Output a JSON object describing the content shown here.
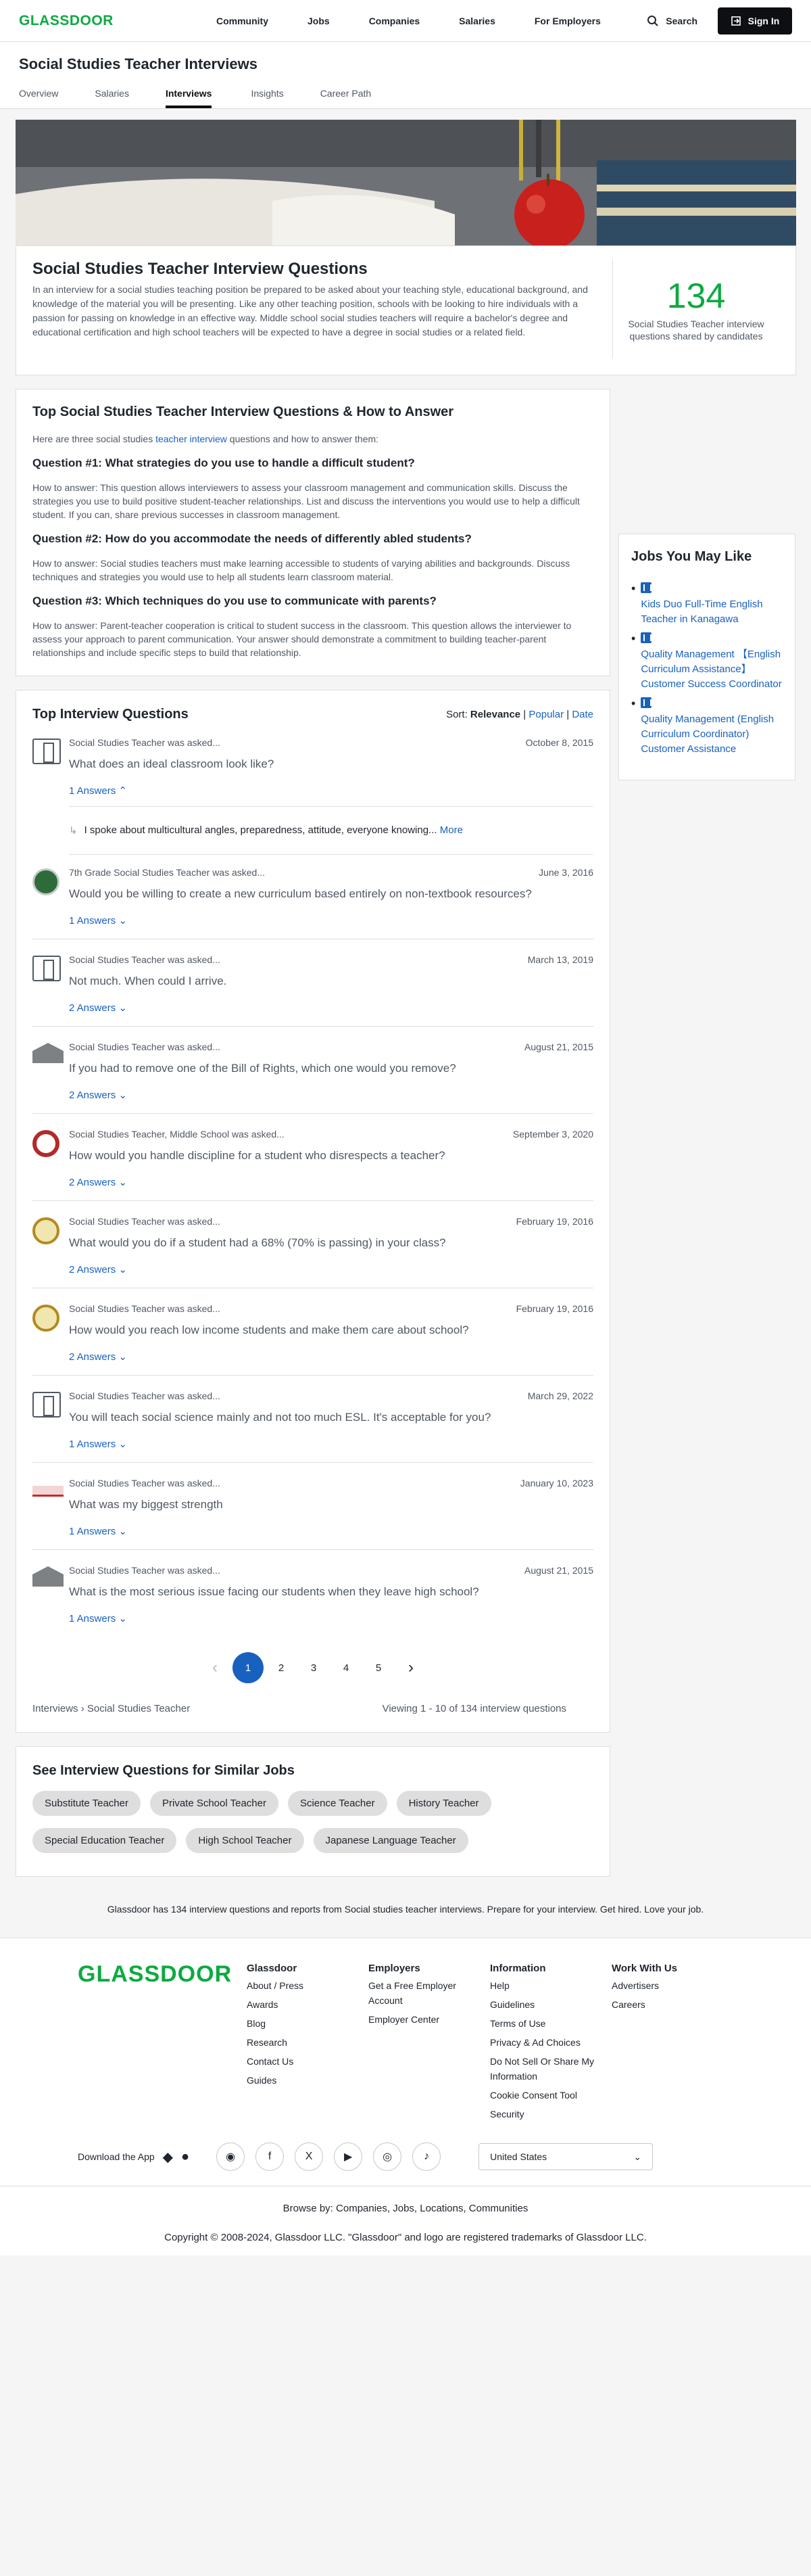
{
  "nav": {
    "logo": "GLASSDOOR",
    "links": [
      "Community",
      "Jobs",
      "Companies",
      "Salaries",
      "For Employers"
    ],
    "search": "Search",
    "signin": "Sign In"
  },
  "page": {
    "title": "Social Studies Teacher Interviews",
    "tabs": [
      "Overview",
      "Salaries",
      "Interviews",
      "Insights",
      "Career Path"
    ],
    "active_tab": "Interviews"
  },
  "intro": {
    "title": "Social Studies Teacher Interview Questions",
    "body": "In an interview for a social studies teaching position be prepared to be asked about your teaching style, educational background, and knowledge of the material you will be presenting. Like any other teaching position, schools with be looking to hire individuals with a passion for passing on knowledge in an effective way. Middle school social studies teachers will require a bachelor's degree and educational certification and high school teachers will be expected to have a degree in social studies or a related field.",
    "count": "134",
    "count_caption": "Social Studies Teacher interview questions shared by candidates"
  },
  "howto": {
    "title": "Top Social Studies Teacher Interview Questions & How to Answer",
    "lead_pre": "Here are three social studies ",
    "lead_link": "teacher interview",
    "lead_post": " questions and how to answer them:",
    "q1": "Question #1: What strategies do you use to handle a difficult student?",
    "a1": "How to answer: This question allows interviewers to assess your classroom management and communication skills. Discuss the strategies you use to build positive student-teacher relationships. List and discuss the interventions you would use to help a difficult student. If you can, share previous successes in classroom management.",
    "q2": "Question #2: How do you accommodate the needs of differently abled students?",
    "a2": "How to answer: Social studies teachers must make learning accessible to students of varying abilities and backgrounds. Discuss techniques and strategies you would use to help all students learn classroom material.",
    "q3": "Question #3: Which techniques do you use to communicate with parents?",
    "a3": "How to answer: Parent-teacher cooperation is critical to student success in the classroom. This question allows the interviewer to assess your approach to parent communication. Your answer should demonstrate a commitment to building teacher-parent relationships and include specific steps to build that relationship."
  },
  "jobs": {
    "title": "Jobs You May Like",
    "items": [
      "Kids Duo Full-Time English Teacher in Kanagawa",
      "Quality Management 【English Curriculum Assistance】 Customer Success Coordinator",
      "Quality Management (English Curriculum Coordinator) Customer Assistance"
    ]
  },
  "questions": {
    "title": "Top Interview Questions",
    "sort_label": "Sort:",
    "sort_options": [
      "Relevance",
      "Popular",
      "Date"
    ],
    "items": [
      {
        "role": "Social Studies Teacher was asked...",
        "date": "October 8, 2015",
        "q": "What does an ideal classroom look like?",
        "answers": "1 Answers"
      },
      {
        "role": "7th Grade Social Studies Teacher was asked...",
        "date": "June 3, 2016",
        "q": "Would you be willing to create a new curriculum based entirely on non-textbook resources?",
        "answers": "1 Answers"
      },
      {
        "role": "Social Studies Teacher was asked...",
        "date": "March 13, 2019",
        "q": "Not much. When could I arrive.",
        "answers": "2 Answers"
      },
      {
        "role": "Social Studies Teacher was asked...",
        "date": "August 21, 2015",
        "q": "If you had to remove one of the Bill of Rights, which one would you remove?",
        "answers": "2 Answers"
      },
      {
        "role": "Social Studies Teacher, Middle School was asked...",
        "date": "September 3, 2020",
        "q": "How would you handle discipline for a student who disrespects a teacher?",
        "answers": "2 Answers"
      },
      {
        "role": "Social Studies Teacher was asked...",
        "date": "February 19, 2016",
        "q": "What would you do if a student had a 68% (70% is passing) in your class?",
        "answers": "2 Answers"
      },
      {
        "role": "Social Studies Teacher was asked...",
        "date": "February 19, 2016",
        "q": "How would you reach low income students and make them care about school?",
        "answers": "2 Answers"
      },
      {
        "role": "Social Studies Teacher was asked...",
        "date": "March 29, 2022",
        "q": "You will teach social science mainly and not too much ESL. It's acceptable for you?",
        "answers": "1 Answers"
      },
      {
        "role": "Social Studies Teacher was asked...",
        "date": "January 10, 2023",
        "q": "What was my biggest strength",
        "answers": "1 Answers"
      },
      {
        "role": "Social Studies Teacher was asked...",
        "date": "August 21, 2015",
        "q": "What is the most serious issue facing our students when they leave high school?",
        "answers": "1 Answers"
      }
    ],
    "expanded_answer": "I spoke about multicultural angles, preparedness, attitude, everyone knowing...",
    "more": "More",
    "pages": [
      "1",
      "2",
      "3",
      "4",
      "5"
    ],
    "breadcrumb_1": "Interviews",
    "breadcrumb_2": "Social Studies Teacher",
    "viewing": "Viewing 1 - 10 of 134 interview questions"
  },
  "similar": {
    "title": "See Interview Questions for Similar Jobs",
    "chips": [
      "Substitute Teacher",
      "Private School Teacher",
      "Science Teacher",
      "History Teacher",
      "Special Education Teacher",
      "High School Teacher",
      "Japanese Language Teacher"
    ]
  },
  "tagline": "Glassdoor has 134 interview questions and reports from Social studies teacher interviews. Prepare for your interview. Get hired. Love your job.",
  "footer": {
    "logo": "GLASSDOOR",
    "cols": [
      {
        "title": "Glassdoor",
        "items": [
          "About / Press",
          "Awards",
          "Blog",
          "Research",
          "Contact Us",
          "Guides"
        ]
      },
      {
        "title": "Employers",
        "items": [
          "Get a Free Employer Account",
          "Employer Center"
        ]
      },
      {
        "title": "Information",
        "items": [
          "Help",
          "Guidelines",
          "Terms of Use",
          "Privacy & Ad Choices",
          "Do Not Sell Or Share My Information",
          "Cookie Consent Tool",
          "Security"
        ]
      },
      {
        "title": "Work With Us",
        "items": [
          "Advertisers",
          "Careers"
        ]
      }
    ],
    "download": "Download the App",
    "country": "United States",
    "browse_label": "Browse by:",
    "browse": "Companies, Jobs, Locations, Communities",
    "copyright": "Copyright © 2008-2024, Glassdoor LLC. \"Glassdoor\" and logo are registered trademarks of Glassdoor LLC."
  }
}
